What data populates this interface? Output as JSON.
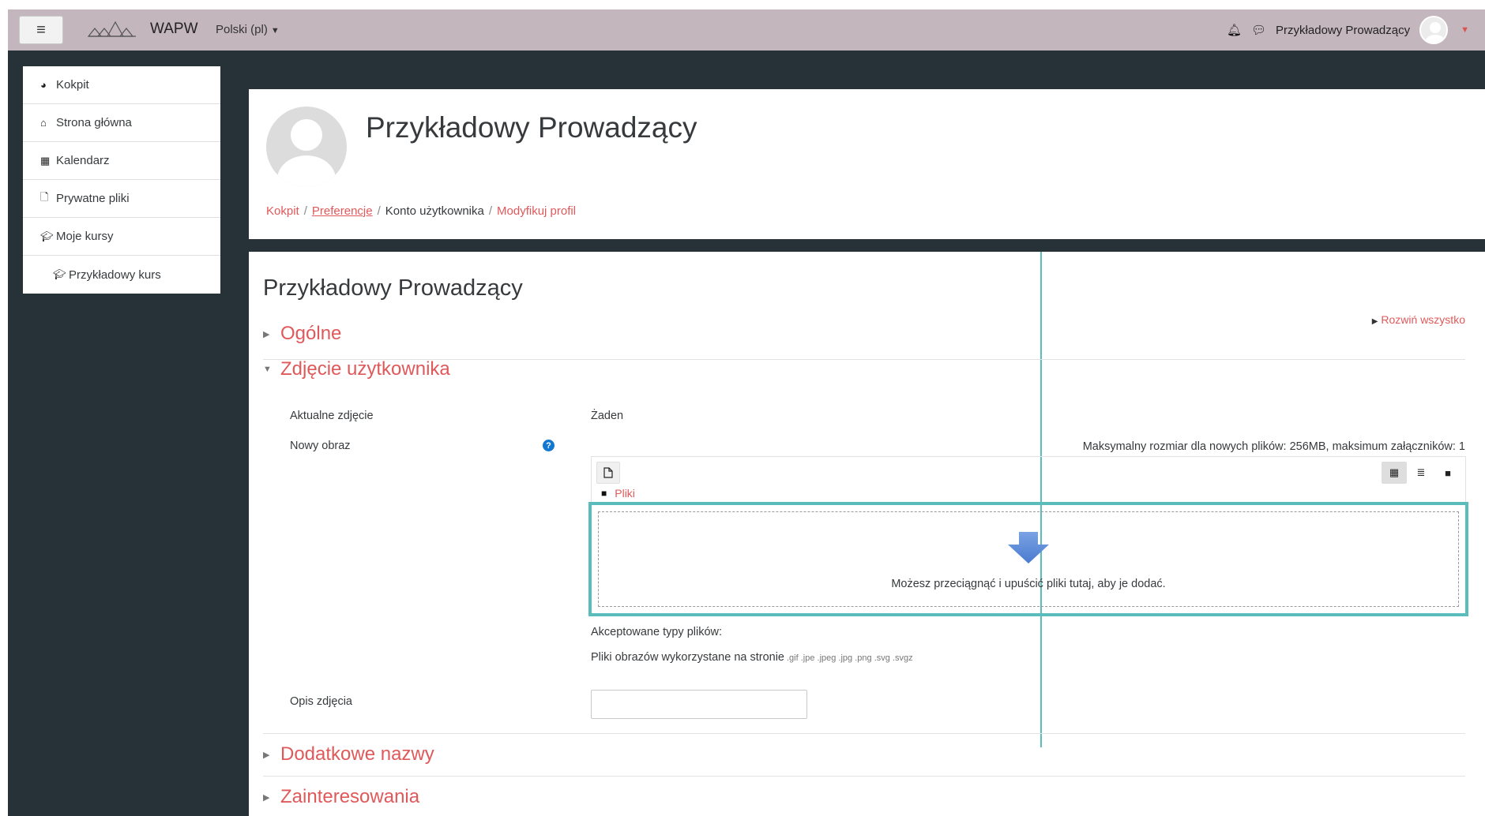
{
  "navbar": {
    "menu_icon": "hamburger-icon",
    "site_name": "WAPW",
    "language": "Polski (pl)",
    "user_name": "Przykładowy Prowadzący",
    "bg_color": "#c4b6bd"
  },
  "drawer": {
    "items": [
      {
        "label": "Kokpit",
        "icon": "dashboard-icon"
      },
      {
        "label": "Strona główna",
        "icon": "home-icon"
      },
      {
        "label": "Kalendarz",
        "icon": "calendar-icon"
      },
      {
        "label": "Prywatne pliki",
        "icon": "file-icon"
      },
      {
        "label": "Moje kursy",
        "icon": "graduation-cap-icon"
      },
      {
        "label": "Przykładowy kurs",
        "icon": "graduation-cap-icon"
      }
    ]
  },
  "header": {
    "title": "Przykładowy Prowadzący",
    "breadcrumb": [
      "Kokpit",
      "Preferencje",
      "Konto użytkownika",
      "Modyfikuj profil"
    ]
  },
  "main": {
    "heading": "Przykładowy Prowadzący",
    "expand_all": "Rozwiń wszystko",
    "sections": {
      "general": "Ogólne",
      "user_picture": "Zdjęcie użytkownika",
      "additional_names": "Dodatkowe nazwy",
      "interests": "Zainteresowania"
    },
    "current_picture_label": "Aktualne zdjęcie",
    "current_picture_value": "Żaden",
    "new_image_label": "Nowy obraz",
    "max_size_text": "Maksymalny rozmiar dla nowych plików: 256MB, maksimum załączników: 1",
    "files_path": "Pliki",
    "drop_text": "Możesz przeciągnąć i upuścić pliki tutaj, aby je dodać.",
    "accepted_label": "Akceptowane typy plików:",
    "accepted_types_text": "Pliki obrazów wykorzystane na stronie",
    "accepted_extensions": ".gif .jpe .jpeg .jpg .png .svg .svgz",
    "image_description_label": "Opis zdjęcia",
    "image_description_value": ""
  },
  "colors": {
    "accent": "#e0595a",
    "highlight": "#5bbcbc",
    "background": "#263238"
  }
}
